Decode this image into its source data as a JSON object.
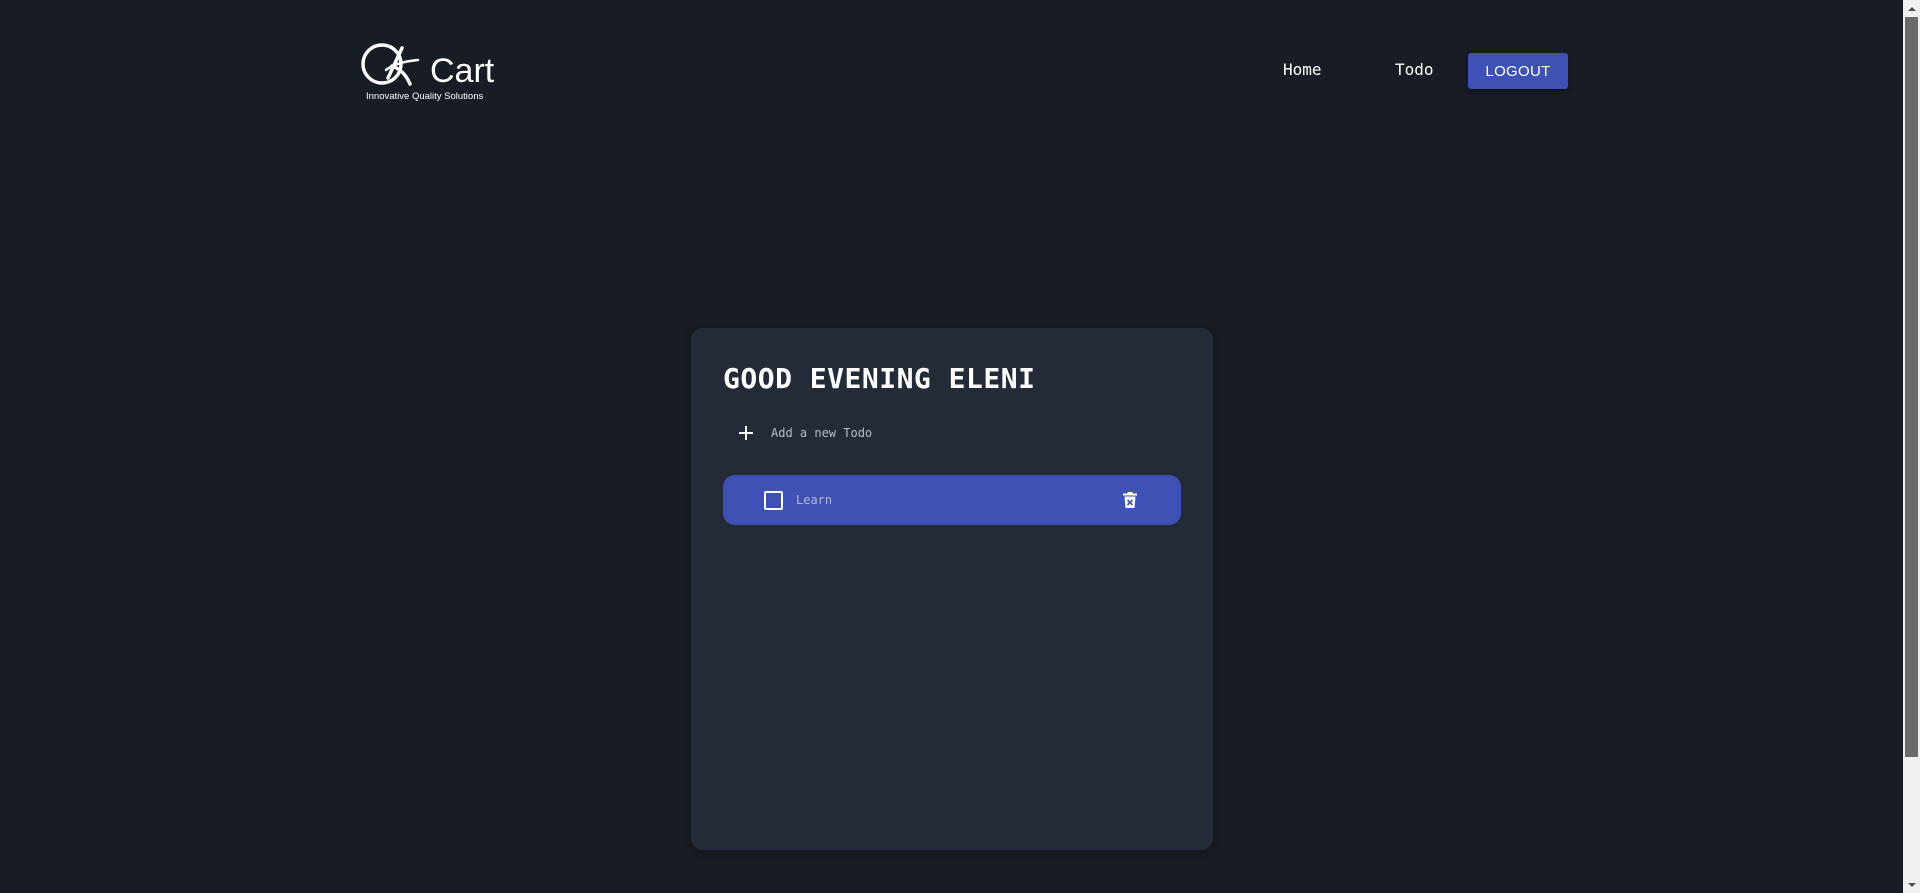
{
  "header": {
    "logo": {
      "main_text": "QKart",
      "tagline": "Innovative Quality Solutions"
    },
    "nav": {
      "home_label": "Home",
      "todo_label": "Todo",
      "logout_label": "LOGOUT"
    }
  },
  "main": {
    "greeting": "GOOD EVENING ELENI",
    "add_todo": {
      "placeholder": "Add a new Todo",
      "value": ""
    },
    "todos": [
      {
        "label": "Learn",
        "checked": false
      }
    ]
  },
  "colors": {
    "background": "#171c25",
    "card": "#222b37",
    "accent": "#3f51b5"
  },
  "icons": {
    "add": "plus-icon",
    "delete": "trash-icon",
    "checkbox": "checkbox-outline-icon"
  }
}
